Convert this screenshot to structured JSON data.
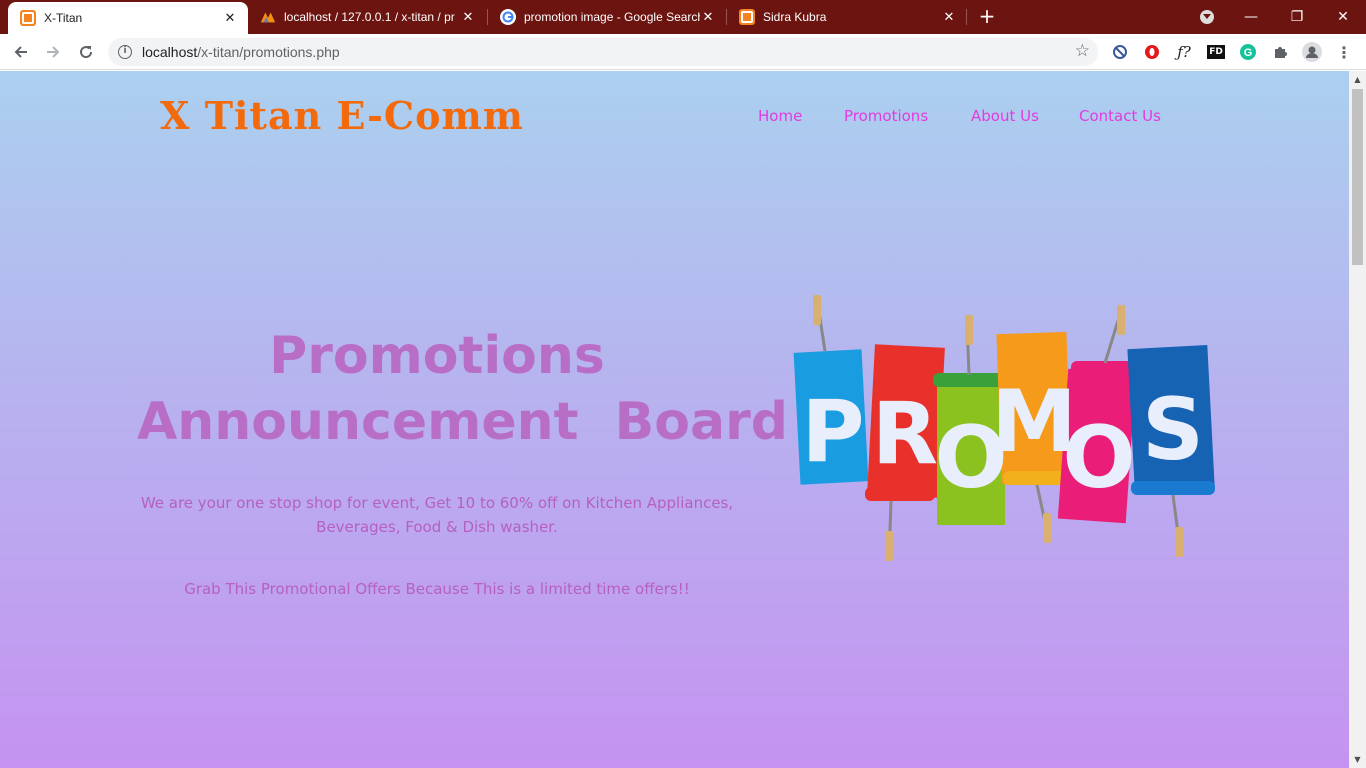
{
  "browser": {
    "tabs": [
      {
        "title": "X-Titan",
        "active": true,
        "favicon": "xampp-icon"
      },
      {
        "title": "localhost / 127.0.0.1 / x-titan / pr",
        "active": false,
        "favicon": "phpmyadmin-icon"
      },
      {
        "title": "promotion image - Google Search",
        "active": false,
        "favicon": "google-icon"
      },
      {
        "title": "Sidra Kubra",
        "active": false,
        "favicon": "xampp-icon"
      }
    ],
    "url_host": "localhost",
    "url_path": "/x-titan/promotions.php"
  },
  "site": {
    "logo": "X Titan E-Comm",
    "nav": [
      "Home",
      "Promotions",
      "About Us",
      "Contact Us"
    ]
  },
  "hero": {
    "heading_line1": "Promotions",
    "heading_line2": "Announcement  Board",
    "description_line1": "We are your one stop shop for event, Get 10 to 60% off on Kitchen Appliances,",
    "description_line2": "Beverages, Food & Dish washer.",
    "grab": "Grab This Promotional Offers Because This is a limited time offers!!",
    "promo_image_letters": [
      "P",
      "R",
      "O",
      "M",
      "O",
      "S"
    ]
  },
  "colors": {
    "tabstrip": "#6b1410",
    "logo": "#f26a0c",
    "nav": "#e13ce0",
    "heading": "#b86ec6",
    "gradient_top": "#abd0ef",
    "gradient_bottom": "#c593f1"
  }
}
